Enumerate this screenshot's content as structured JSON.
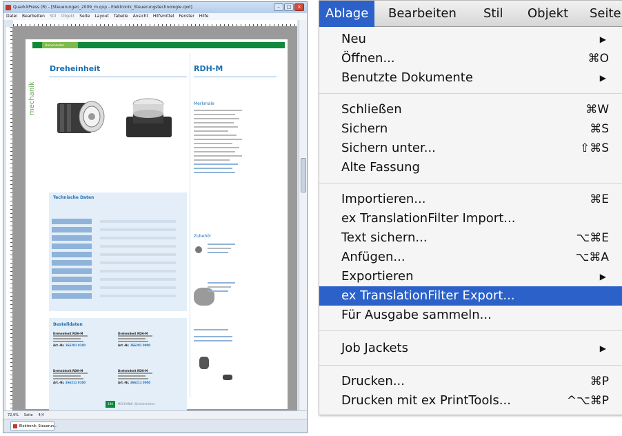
{
  "qx_window": {
    "title": "QuarkXPress (R) - [Steuerungen_2009_m.qxp - Elektronik_Steuerungstechnologie.qxd]",
    "menus": [
      {
        "label": "Datei",
        "dim": false
      },
      {
        "label": "Bearbeiten",
        "dim": false
      },
      {
        "label": "Stil",
        "dim": true
      },
      {
        "label": "Objekt",
        "dim": true
      },
      {
        "label": "Seite",
        "dim": false
      },
      {
        "label": "Layout",
        "dim": false
      },
      {
        "label": "Tabelle",
        "dim": false
      },
      {
        "label": "Ansicht",
        "dim": false
      },
      {
        "label": "Hilfsmittel",
        "dim": false
      },
      {
        "label": "Fenster",
        "dim": false
      },
      {
        "label": "Hilfe",
        "dim": false
      }
    ],
    "status": {
      "zoom": "72,9%",
      "page_label": "Seite",
      "page_value": "4/4"
    },
    "doc_tab": "Elektronik_Steuerun...",
    "page": {
      "header_tab": "Dreheinheiten",
      "side_label": "mechanik",
      "title_left": "Dreheinheit",
      "title_right": "RDH-M",
      "merkmale_title": "Merkmale",
      "tech_title": "Technische Daten",
      "order_title": "Bestelldaten",
      "zubehoer_title": "Zubehör",
      "order_items": [
        {
          "name": "Dreheinheit RDH-M",
          "art": "Art.-Nr.",
          "num": "266201 0100"
        },
        {
          "name": "Dreheinheit RDH-M",
          "art": "Art.-Nr.",
          "num": "266201 0000"
        },
        {
          "name": "Dreheinheit RDH-M",
          "art": "Art.-Nr.",
          "num": "266211 0100"
        },
        {
          "name": "Dreheinheit RDH-M",
          "art": "Art.-Nr.",
          "num": "266211 0000"
        }
      ],
      "footer_badge": "194",
      "footer_text": "MECHANIK  |  Dreheinheiten"
    }
  },
  "mac_menu": {
    "menubar": [
      {
        "label": "Ablage",
        "active": true
      },
      {
        "label": "Bearbeiten",
        "active": false
      },
      {
        "label": "Stil",
        "active": false
      },
      {
        "label": "Objekt",
        "active": false
      },
      {
        "label": "Seite",
        "active": false
      }
    ],
    "items": [
      {
        "label": "Neu",
        "shortcut": "",
        "submenu": true
      },
      {
        "label": "Öffnen...",
        "shortcut": "⌘O",
        "submenu": false
      },
      {
        "label": "Benutzte Dokumente",
        "shortcut": "",
        "submenu": true
      },
      {
        "label": "Schließen",
        "shortcut": "⌘W",
        "submenu": false
      },
      {
        "label": "Sichern",
        "shortcut": "⌘S",
        "submenu": false
      },
      {
        "label": "Sichern unter...",
        "shortcut": "⇧⌘S",
        "submenu": false
      },
      {
        "label": "Alte Fassung",
        "shortcut": "",
        "submenu": false
      },
      {
        "label": "Importieren...",
        "shortcut": "⌘E",
        "submenu": false
      },
      {
        "label": "ex TranslationFilter Import...",
        "shortcut": "",
        "submenu": false
      },
      {
        "label": "Text sichern...",
        "shortcut": "⌥⌘E",
        "submenu": false
      },
      {
        "label": "Anfügen...",
        "shortcut": "⌥⌘A",
        "submenu": false
      },
      {
        "label": "Exportieren",
        "shortcut": "",
        "submenu": true
      },
      {
        "label": "ex TranslationFilter Export...",
        "shortcut": "",
        "submenu": false,
        "highlighted": true
      },
      {
        "label": "Für Ausgabe sammeln...",
        "shortcut": "",
        "submenu": false
      },
      {
        "label": "Job Jackets",
        "shortcut": "",
        "submenu": true
      },
      {
        "label": "Drucken...",
        "shortcut": "⌘P",
        "submenu": false
      },
      {
        "label": "Drucken mit ex PrintTools...",
        "shortcut": "^⌥⌘P",
        "submenu": false
      }
    ],
    "highlight_color": "#2b61c9"
  }
}
